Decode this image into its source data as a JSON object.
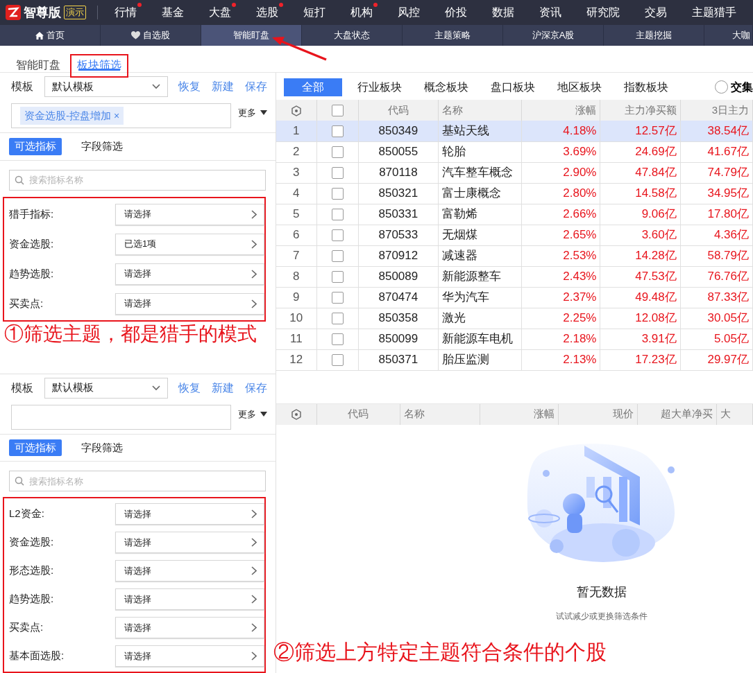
{
  "brand": {
    "name": "智尊版",
    "badge": "演示"
  },
  "top_menu": [
    {
      "label": "行情",
      "dot": true
    },
    {
      "label": "基金",
      "dot": false
    },
    {
      "label": "大盘",
      "dot": true
    },
    {
      "label": "选股",
      "dot": true
    },
    {
      "label": "短打",
      "dot": false
    },
    {
      "label": "机构",
      "dot": true
    },
    {
      "label": "风控",
      "dot": false
    },
    {
      "label": "价投",
      "dot": false
    },
    {
      "label": "数据",
      "dot": false
    },
    {
      "label": "资讯",
      "dot": false
    },
    {
      "label": "研究院",
      "dot": false
    },
    {
      "label": "交易",
      "dot": false
    },
    {
      "label": "主题猎手",
      "dot": false
    }
  ],
  "nav_tabs": [
    {
      "label": "首页",
      "kind": "home",
      "selected": false
    },
    {
      "label": "自选股",
      "kind": "favorites",
      "selected": false
    },
    {
      "label": "智能盯盘",
      "selected": true
    },
    {
      "label": "大盘状态",
      "selected": false
    },
    {
      "label": "主题策略",
      "selected": false
    },
    {
      "label": "沪深京A股",
      "selected": false
    },
    {
      "label": "主题挖掘",
      "selected": false
    },
    {
      "label": "大咖",
      "selected": false
    }
  ],
  "pointer_arrow": true,
  "sub_tabs": [
    {
      "label": "智能盯盘",
      "selected": false,
      "highlighted": false
    },
    {
      "label": "板块筛选",
      "selected": true,
      "highlighted": true
    }
  ],
  "filter_panels": [
    {
      "template_label": "模板",
      "template_value": "默认模板",
      "actions": [
        "恢复",
        "新建",
        "保存"
      ],
      "tags": [
        {
          "label": "资金选股-控盘增加",
          "remove": "×"
        }
      ],
      "more": "更多",
      "modes": [
        {
          "label": "可选指标",
          "selected": true
        },
        {
          "label": "字段筛选",
          "selected": false
        }
      ],
      "search": {
        "placeholder": "搜索指标名称"
      },
      "highlighted": true,
      "criteria": [
        {
          "label": "猎手指标:",
          "value": "请选择"
        },
        {
          "label": "资金选股:",
          "value": "已选1项"
        },
        {
          "label": "趋势选股:",
          "value": "请选择"
        },
        {
          "label": "买卖点:",
          "value": "请选择"
        }
      ],
      "annotation": "①筛选主题，都是猎手的模式"
    },
    {
      "template_label": "模板",
      "template_value": "默认模板",
      "actions": [
        "恢复",
        "新建",
        "保存"
      ],
      "more": "更多",
      "modes": [
        {
          "label": "可选指标",
          "selected": true
        },
        {
          "label": "字段筛选",
          "selected": false
        }
      ],
      "search": {
        "placeholder": "搜索指标名称"
      },
      "highlighted": true,
      "criteria": [
        {
          "label": "L2资金:",
          "value": "请选择"
        },
        {
          "label": "资金选股:",
          "value": "请选择"
        },
        {
          "label": "形态选股:",
          "value": "请选择"
        },
        {
          "label": "趋势选股:",
          "value": "请选择"
        },
        {
          "label": "买卖点:",
          "value": "请选择"
        },
        {
          "label": "基本面选股:",
          "value": "请选择"
        }
      ]
    }
  ],
  "sector_tabs": [
    {
      "label": "全部",
      "selected": true
    },
    {
      "label": "行业板块",
      "selected": false
    },
    {
      "label": "概念板块",
      "selected": false
    },
    {
      "label": "盘口板块",
      "selected": false
    },
    {
      "label": "地区板块",
      "selected": false
    },
    {
      "label": "指数板块",
      "selected": false
    }
  ],
  "intersection_option": {
    "label": "交集",
    "checked": false
  },
  "sector_table": {
    "select_all_checked": false,
    "columns": [
      "代码",
      "名称",
      "涨幅",
      "主力净买额",
      "3日主力"
    ],
    "rows": [
      {
        "index": "1",
        "selected": true,
        "checked": false,
        "code": "850349",
        "name": "基站天线",
        "change": "4.18%",
        "net_buy": "12.57亿",
        "net_buy_3d": "38.54亿"
      },
      {
        "index": "2",
        "selected": false,
        "checked": false,
        "code": "850055",
        "name": "轮胎",
        "change": "3.69%",
        "net_buy": "24.69亿",
        "net_buy_3d": "41.67亿"
      },
      {
        "index": "3",
        "selected": false,
        "checked": false,
        "code": "870118",
        "name": "汽车整车概念",
        "change": "2.90%",
        "net_buy": "47.84亿",
        "net_buy_3d": "74.79亿"
      },
      {
        "index": "4",
        "selected": false,
        "checked": false,
        "code": "850321",
        "name": "富士康概念",
        "change": "2.80%",
        "net_buy": "14.58亿",
        "net_buy_3d": "34.95亿"
      },
      {
        "index": "5",
        "selected": false,
        "checked": false,
        "code": "850331",
        "name": "富勒烯",
        "change": "2.66%",
        "net_buy": "9.06亿",
        "net_buy_3d": "17.80亿"
      },
      {
        "index": "6",
        "selected": false,
        "checked": false,
        "code": "870533",
        "name": "无烟煤",
        "change": "2.65%",
        "net_buy": "3.60亿",
        "net_buy_3d": "4.36亿"
      },
      {
        "index": "7",
        "selected": false,
        "checked": false,
        "code": "870912",
        "name": "减速器",
        "change": "2.53%",
        "net_buy": "14.28亿",
        "net_buy_3d": "58.79亿"
      },
      {
        "index": "8",
        "selected": false,
        "checked": false,
        "code": "850089",
        "name": "新能源整车",
        "change": "2.43%",
        "net_buy": "47.53亿",
        "net_buy_3d": "76.76亿"
      },
      {
        "index": "9",
        "selected": false,
        "checked": false,
        "code": "870474",
        "name": "华为汽车",
        "change": "2.37%",
        "net_buy": "49.48亿",
        "net_buy_3d": "87.33亿"
      },
      {
        "index": "10",
        "selected": false,
        "checked": false,
        "code": "850358",
        "name": "激光",
        "change": "2.25%",
        "net_buy": "12.08亿",
        "net_buy_3d": "30.05亿"
      },
      {
        "index": "11",
        "selected": false,
        "checked": false,
        "code": "850099",
        "name": "新能源车电机",
        "change": "2.18%",
        "net_buy": "3.91亿",
        "net_buy_3d": "5.05亿"
      },
      {
        "index": "12",
        "selected": false,
        "checked": false,
        "code": "850371",
        "name": "胎压监测",
        "change": "2.13%",
        "net_buy": "17.23亿",
        "net_buy_3d": "29.97亿"
      }
    ]
  },
  "stock_table": {
    "columns": [
      "代码",
      "名称",
      "涨幅",
      "现价",
      "超大单净买",
      "大"
    ]
  },
  "empty_state": {
    "title": "暂无数据",
    "hint": "试试减少或更换筛选条件"
  },
  "bottom_annotation": "②筛选上方特定主题符合条件的个股"
}
